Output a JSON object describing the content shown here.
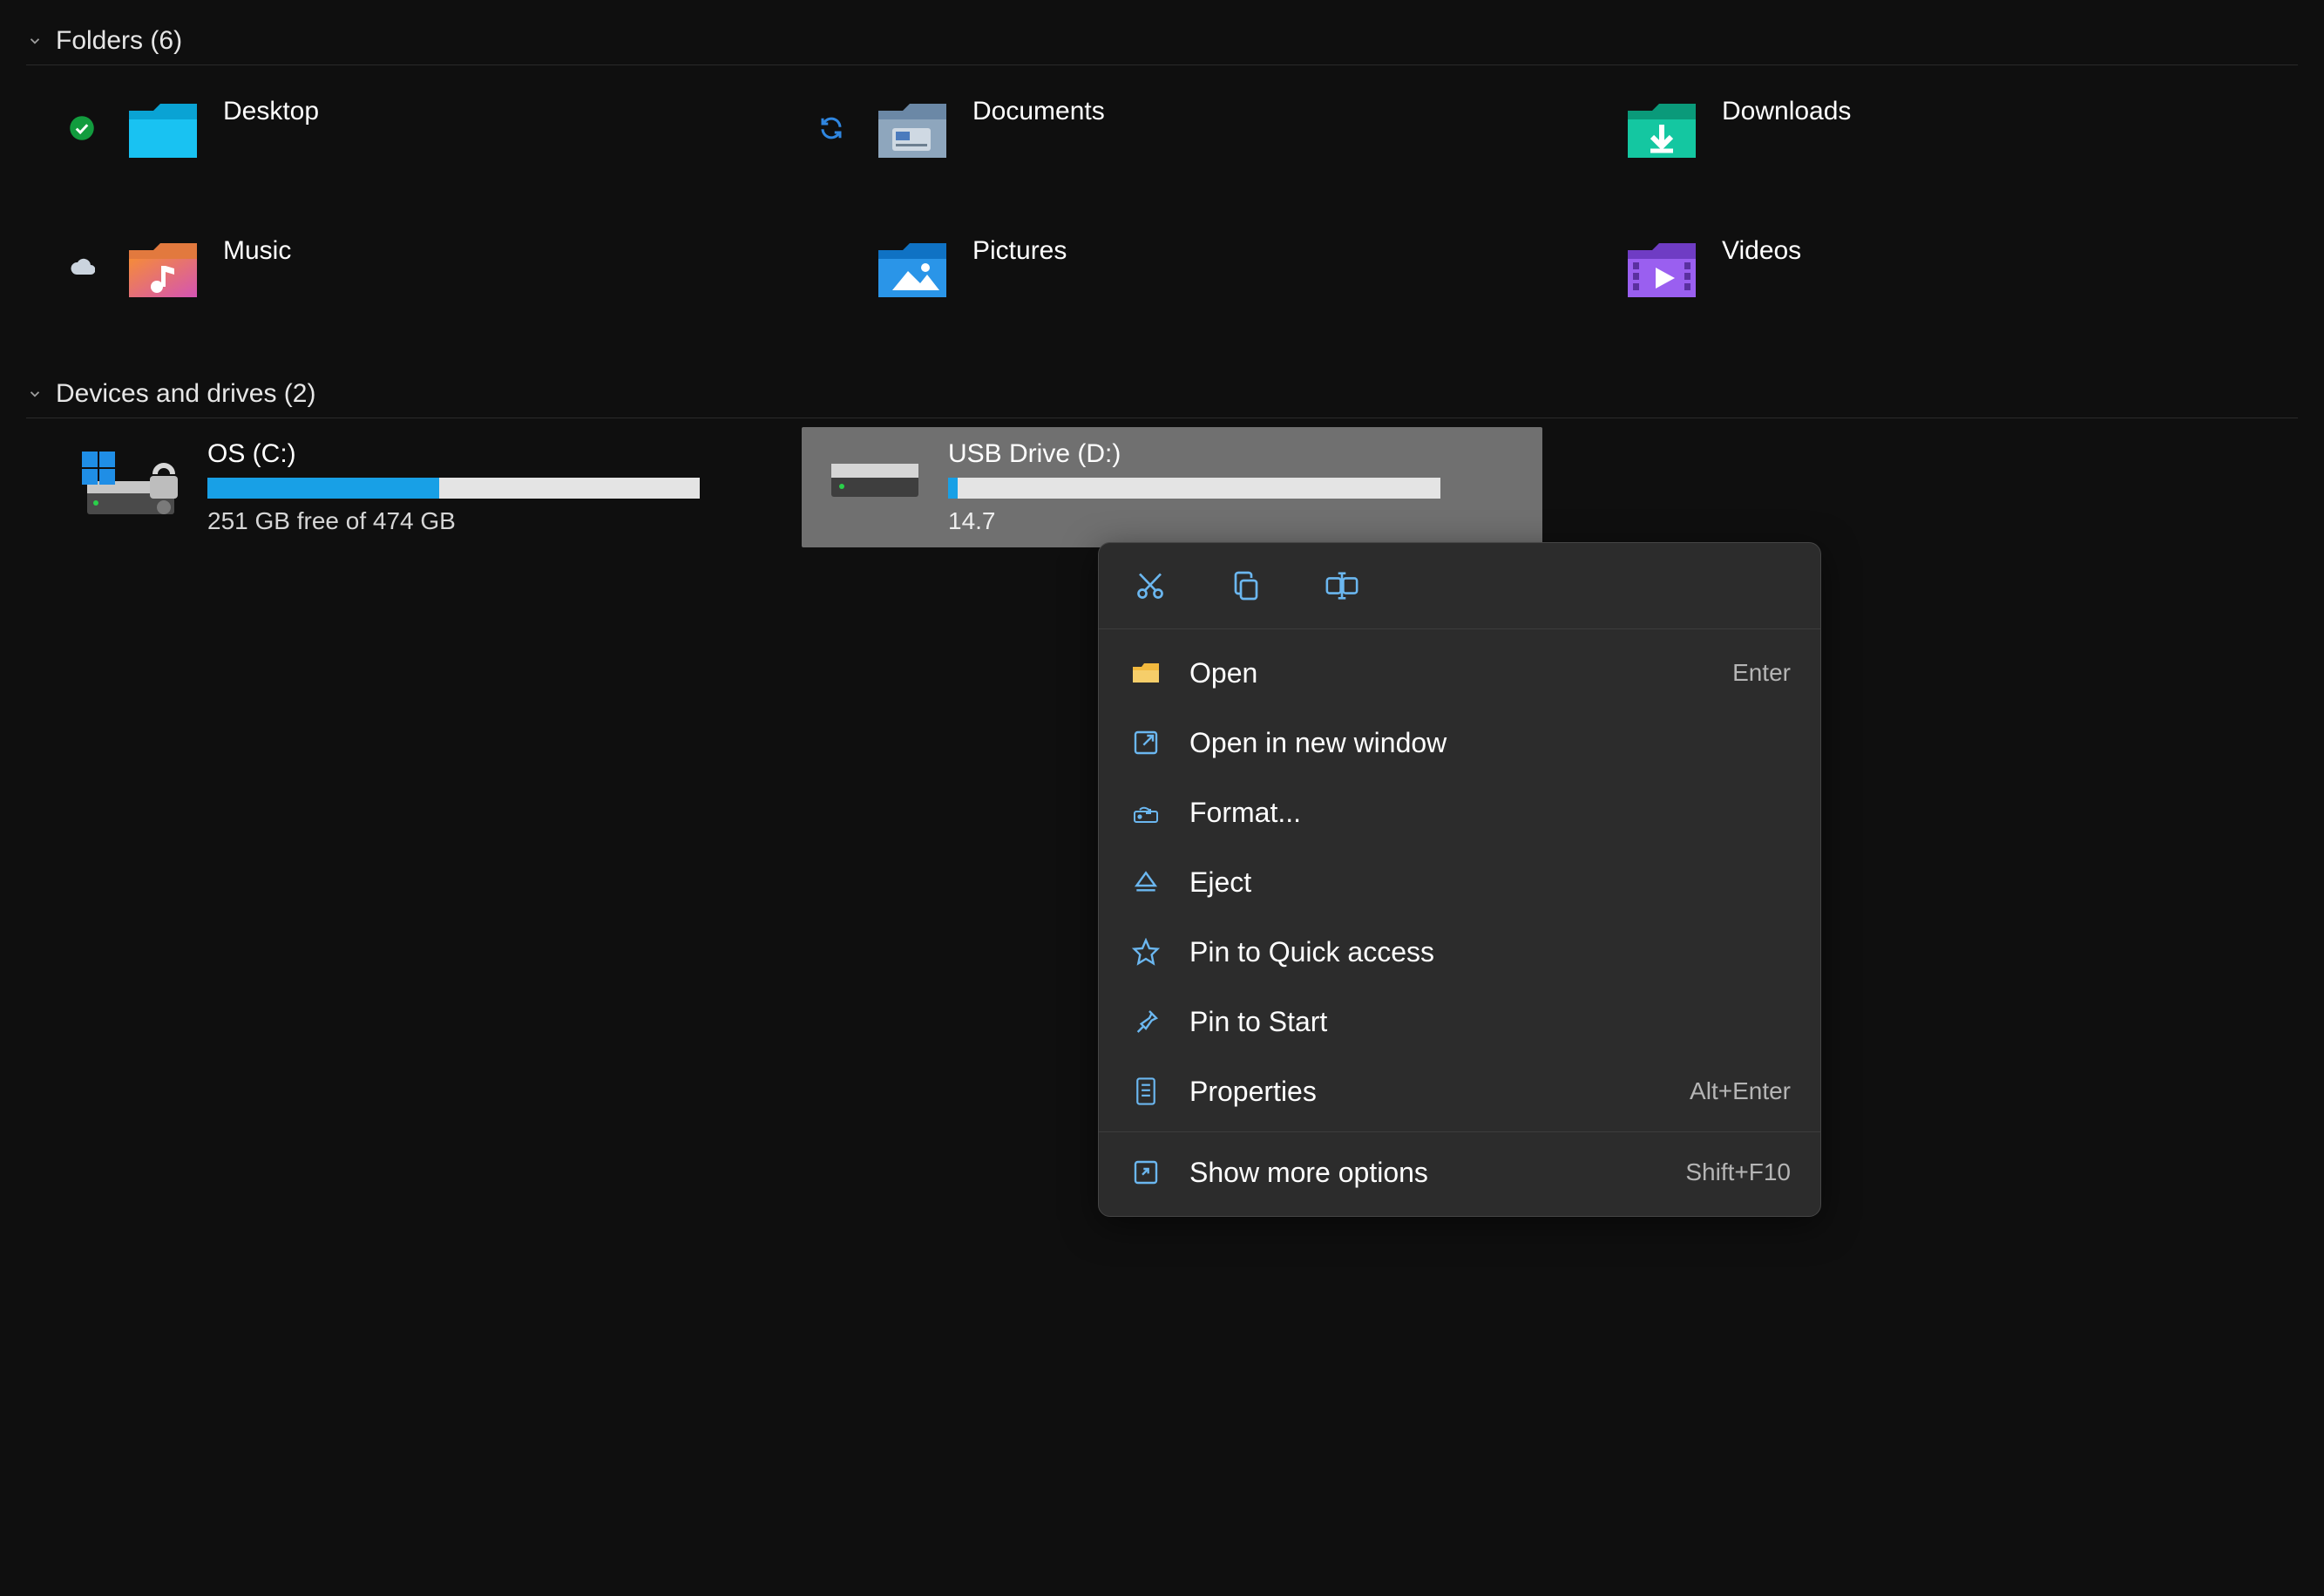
{
  "sections": {
    "folders": {
      "label": "Folders",
      "count": "(6)"
    },
    "drives": {
      "label": "Devices and drives",
      "count": "(2)"
    }
  },
  "folders": [
    {
      "name": "Desktop",
      "status": "synced"
    },
    {
      "name": "Documents",
      "status": "syncing"
    },
    {
      "name": "Downloads",
      "status": ""
    },
    {
      "name": "Music",
      "status": "cloud"
    },
    {
      "name": "Pictures",
      "status": ""
    },
    {
      "name": "Videos",
      "status": ""
    }
  ],
  "drives": [
    {
      "name": "OS (C:)",
      "free_text": "251 GB free of 474 GB",
      "fill_pct": 47,
      "selected": false
    },
    {
      "name": "USB Drive (D:)",
      "free_text": "14.7",
      "fill_pct": 2,
      "selected": true
    }
  ],
  "context_menu": {
    "top_actions": [
      "cut",
      "copy",
      "rename"
    ],
    "items": [
      {
        "icon": "open-icon",
        "label": "Open",
        "shortcut": "Enter"
      },
      {
        "icon": "new-window-icon",
        "label": "Open in new window",
        "shortcut": ""
      },
      {
        "icon": "format-icon",
        "label": "Format...",
        "shortcut": ""
      },
      {
        "icon": "eject-icon",
        "label": "Eject",
        "shortcut": ""
      },
      {
        "icon": "star-icon",
        "label": "Pin to Quick access",
        "shortcut": ""
      },
      {
        "icon": "pin-icon",
        "label": "Pin to Start",
        "shortcut": ""
      },
      {
        "icon": "properties-icon",
        "label": "Properties",
        "shortcut": "Alt+Enter"
      }
    ],
    "more": {
      "icon": "more-icon",
      "label": "Show more options",
      "shortcut": "Shift+F10"
    }
  }
}
